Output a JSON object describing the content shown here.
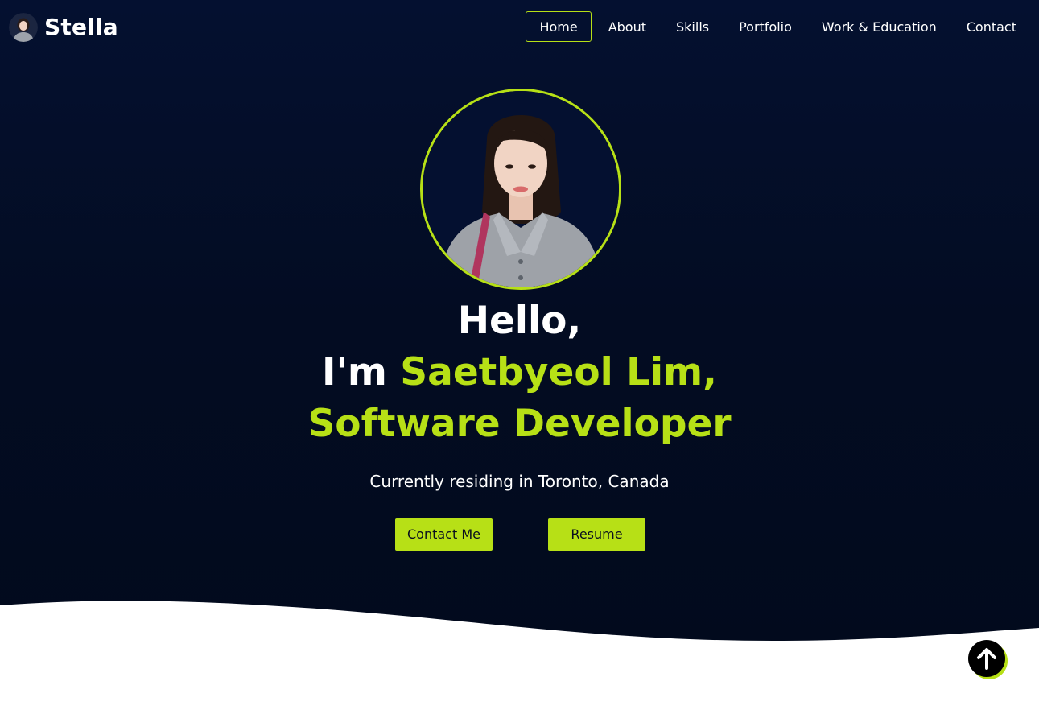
{
  "brand": {
    "name": "Stella",
    "avatar_icon": "avatar-photo"
  },
  "nav": {
    "items": [
      {
        "label": "Home",
        "active": true
      },
      {
        "label": "About",
        "active": false
      },
      {
        "label": "Skills",
        "active": false
      },
      {
        "label": "Portfolio",
        "active": false
      },
      {
        "label": "Work & Education",
        "active": false
      },
      {
        "label": "Contact",
        "active": false
      }
    ]
  },
  "hero": {
    "greeting": "Hello,",
    "intro_prefix": "I'm ",
    "name": "Saetbyeol Lim,",
    "title": "Software Developer",
    "location": "Currently residing in Toronto, Canada",
    "contact_button": "Contact Me",
    "resume_button": "Resume",
    "profile_icon": "profile-photo"
  },
  "scroll_top": {
    "icon": "arrow-up-icon"
  },
  "colors": {
    "accent": "#b7e016",
    "background": "#030c22",
    "text": "#ffffff",
    "wave": "#ffffff"
  }
}
